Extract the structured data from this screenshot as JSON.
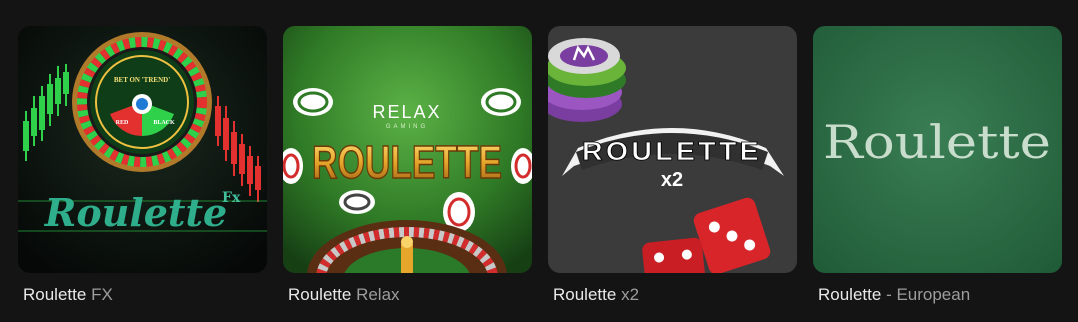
{
  "games": [
    {
      "name": "Roulette",
      "variant": "FX",
      "art": {
        "logo_text": "Roulette",
        "logo_sup": "Fx",
        "wheel_labels": [
          "BET ON 'TREND'",
          "RED",
          "BLACK"
        ]
      }
    },
    {
      "name": "Roulette",
      "variant": "Relax",
      "art": {
        "brand": "RELAX",
        "brand_sub": "GAMING",
        "title": "ROULETTE"
      }
    },
    {
      "name": "Roulette",
      "variant": "x2",
      "art": {
        "title": "ROULETTE",
        "subtitle": "x2"
      }
    },
    {
      "name": "Roulette",
      "variant": "- European",
      "art": {
        "title": "Roulette"
      }
    }
  ],
  "colors": {
    "background": "#141414",
    "caption_name": "#e9e9e9",
    "caption_variant": "#9d9d9d",
    "felt_green": "#2e6e45",
    "relax_gold": "#e6a62b"
  }
}
